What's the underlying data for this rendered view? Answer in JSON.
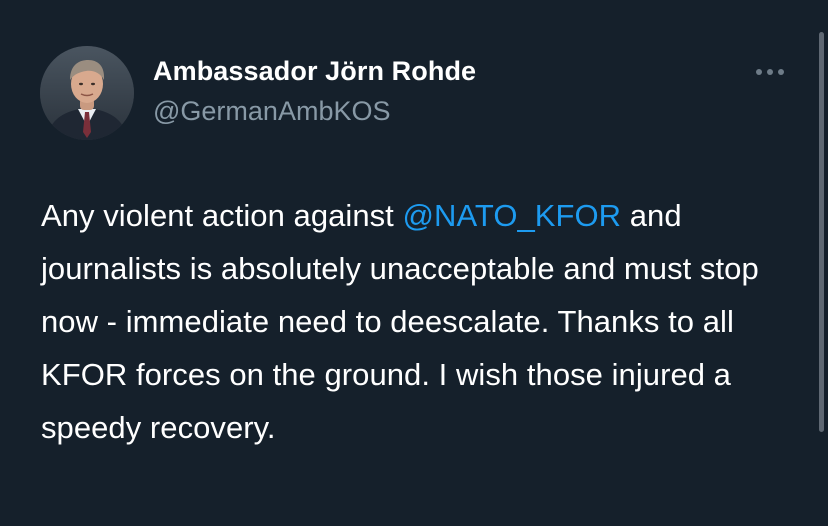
{
  "tweet": {
    "display_name": "Ambassador Jörn Rohde",
    "handle": "@GermanAmbKOS",
    "more_icon": "more-horizontal-icon",
    "text_before": "Any violent action against ",
    "mention": "@NATO_KFOR",
    "text_after": " and journalists is absolutely unacceptable and must stop now - immediate need to deescalate. Thanks to all KFOR forces on the ground. I wish those injured a speedy recovery."
  },
  "colors": {
    "background": "#15202b",
    "text": "#ffffff",
    "handle": "#8899a6",
    "mention": "#1d9bf0",
    "more_dots": "#6e7c88",
    "scrollbar": "#5f6873"
  }
}
